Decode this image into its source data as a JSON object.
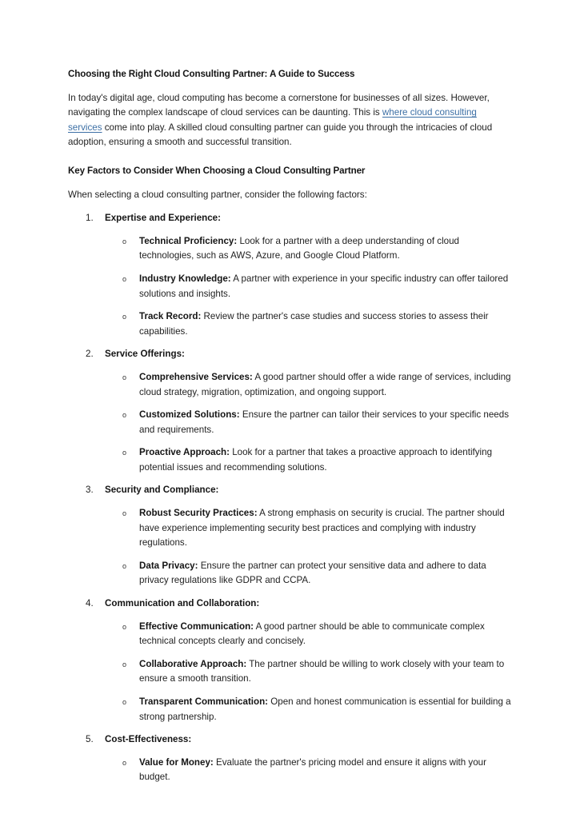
{
  "document": {
    "title": "Choosing the Right Cloud Consulting Partner: A Guide to Success",
    "intro": {
      "part1": "In today's digital age, cloud computing has become a cornerstone for businesses of all sizes. However, navigating the complex landscape of cloud services can be daunting. This is ",
      "link_text": "where cloud consulting services",
      "part2": " come into play. A skilled cloud consulting partner can guide you through the intricacies of cloud adoption, ensuring a smooth and successful transition."
    },
    "section_heading": "Key Factors to Consider When Choosing a Cloud Consulting Partner",
    "section_intro": "When selecting a cloud consulting partner, consider the following factors:",
    "link_color": "#3c6fa5",
    "factors": [
      {
        "number": "1.",
        "title": "Expertise and Experience:",
        "items": [
          {
            "marker": "o",
            "term": "Technical Proficiency:",
            "text": " Look for a partner with a deep understanding of cloud technologies, such as AWS, Azure, and Google Cloud Platform."
          },
          {
            "marker": "o",
            "term": "Industry Knowledge:",
            "text": " A partner with experience in your specific industry can offer tailored solutions and insights."
          },
          {
            "marker": "o",
            "term": "Track Record:",
            "text": " Review the partner's case studies and success stories to assess their capabilities."
          }
        ]
      },
      {
        "number": "2.",
        "title": "Service Offerings:",
        "items": [
          {
            "marker": "o",
            "term": "Comprehensive Services:",
            "text": " A good partner should offer a wide range of services, including cloud strategy, migration, optimization, and ongoing support."
          },
          {
            "marker": "o",
            "term": "Customized Solutions:",
            "text": " Ensure the partner can tailor their services to your specific needs and requirements."
          },
          {
            "marker": "o",
            "term": "Proactive Approach:",
            "text": " Look for a partner that takes a proactive approach to identifying potential issues and recommending solutions."
          }
        ]
      },
      {
        "number": "3.",
        "title": "Security and Compliance:",
        "items": [
          {
            "marker": "o",
            "term": "Robust Security Practices:",
            "text": " A strong emphasis on security is crucial. The partner should have experience implementing security best practices and complying with industry regulations."
          },
          {
            "marker": "o",
            "term": "Data Privacy:",
            "text": " Ensure the partner can protect your sensitive data and adhere to data privacy regulations like GDPR and CCPA."
          }
        ]
      },
      {
        "number": "4.",
        "title": "Communication and Collaboration:",
        "items": [
          {
            "marker": "o",
            "term": "Effective Communication:",
            "text": " A good partner should be able to communicate complex technical concepts clearly and concisely."
          },
          {
            "marker": "o",
            "term": "Collaborative Approach:",
            "text": " The partner should be willing to work closely with your team to ensure a smooth transition."
          },
          {
            "marker": "o",
            "term": "Transparent Communication:",
            "text": " Open and honest communication is essential for building a strong partnership."
          }
        ]
      },
      {
        "number": "5.",
        "title": "Cost-Effectiveness:",
        "items": [
          {
            "marker": "o",
            "term": "Value for Money:",
            "text": " Evaluate the partner's pricing model and ensure it aligns with your budget."
          }
        ]
      }
    ]
  }
}
